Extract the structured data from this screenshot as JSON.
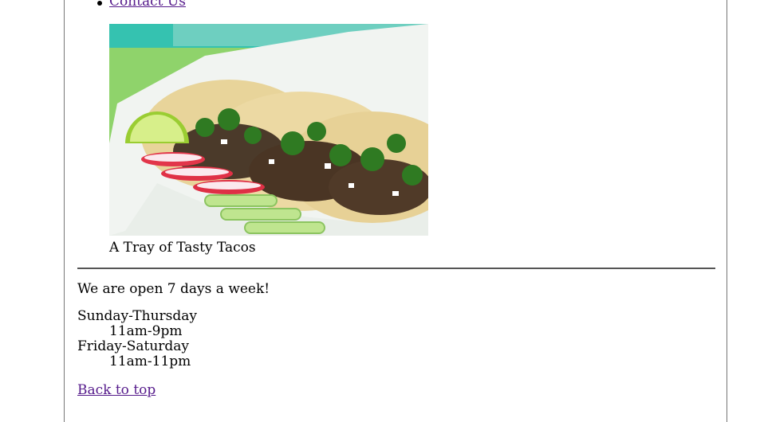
{
  "nav": {
    "items": [
      {
        "label": "Contact Us"
      }
    ]
  },
  "figure": {
    "image_description_icon": "tacos-photo",
    "caption": "A Tray of Tasty Tacos"
  },
  "footer": {
    "open_text": "We are open 7 days a week!",
    "hours": [
      {
        "days": "Sunday-Thursday",
        "time": "11am-9pm"
      },
      {
        "days": "Friday-Saturday",
        "time": "11am-11pm"
      }
    ],
    "back_to_top": "Back to top"
  },
  "colors": {
    "link": "#551a8b",
    "frame_border": "#767676"
  }
}
